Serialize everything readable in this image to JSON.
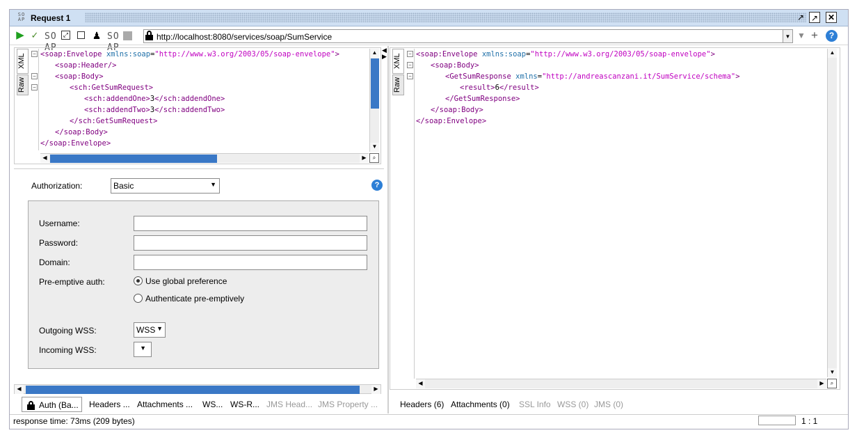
{
  "window": {
    "title": "Request 1",
    "logo": "SO AP"
  },
  "toolbar": {
    "url": "http://localhost:8080/services/soap/SumService",
    "icons": [
      "run-icon",
      "validate-icon",
      "soap-add-icon",
      "expand-icon",
      "stop-box-icon",
      "user-icon",
      "soap-icon",
      "stop-icon",
      "lock-icon"
    ]
  },
  "request": {
    "side_tabs": [
      "XML",
      "Raw"
    ],
    "lines": [
      {
        "indent": 0,
        "open": "<soap:Envelope",
        "attr": " xmlns:soap",
        "eq": "=",
        "val": "\"http://www.w3.org/2003/05/soap-envelope\"",
        "close": ">"
      },
      {
        "indent": 1,
        "text": "<soap:Header/>"
      },
      {
        "indent": 1,
        "text": "<soap:Body>"
      },
      {
        "indent": 2,
        "text": "<sch:GetSumRequest>"
      },
      {
        "indent": 3,
        "text": "<sch:addendOne>",
        "value": "3",
        "end": "</sch:addendOne>"
      },
      {
        "indent": 3,
        "text": "<sch:addendTwo>",
        "value": "3",
        "end": "</sch:addendTwo>"
      },
      {
        "indent": 2,
        "text": "</sch:GetSumRequest>"
      },
      {
        "indent": 1,
        "text": "</soap:Body>"
      },
      {
        "indent": 0,
        "text": "</soap:Envelope>"
      }
    ]
  },
  "response": {
    "side_tabs": [
      "XML",
      "Raw"
    ],
    "line1_open": "<soap:Envelope",
    "line1_attr": " xmlns:soap",
    "line1_val": "\"http://www.w3.org/2003/05/soap-envelope\"",
    "line2": "<soap:Body>",
    "line3_open": "<GetSumResponse",
    "line3_attr": " xmlns",
    "line3_val": "\"http://andreascanzani.it/SumService/schema\"",
    "line4_open": "<result>",
    "line4_value": "6",
    "line4_end": "</result>",
    "line5": "</GetSumResponse>",
    "line6": "</soap:Body>",
    "line7": "</soap:Envelope>"
  },
  "auth": {
    "authorization_label": "Authorization:",
    "authorization_value": "Basic",
    "username_label": "Username:",
    "password_label": "Password:",
    "domain_label": "Domain:",
    "preemptive_label": "Pre-emptive auth:",
    "radio_global": "Use global preference",
    "radio_preemptive": "Authenticate pre-emptively",
    "outgoing_label": "Outgoing WSS:",
    "outgoing_value": "WSS",
    "incoming_label": "Incoming WSS:",
    "incoming_value": ""
  },
  "request_tabs": [
    "Auth (Ba...",
    "Headers ...",
    "Attachments ...",
    "WS...",
    "WS-R...",
    "JMS Head...",
    "JMS Property ..."
  ],
  "response_tabs": [
    "Headers (6)",
    "Attachments (0)",
    "SSL Info",
    "WSS (0)",
    "JMS (0)"
  ],
  "status": {
    "response_time": "response time: 73ms (209 bytes)",
    "position": "1 : 1"
  },
  "colors": {
    "tag": "#800080",
    "namespace": "#1e6fa8",
    "string": "#c000c0",
    "accent": "#3a78c6"
  }
}
